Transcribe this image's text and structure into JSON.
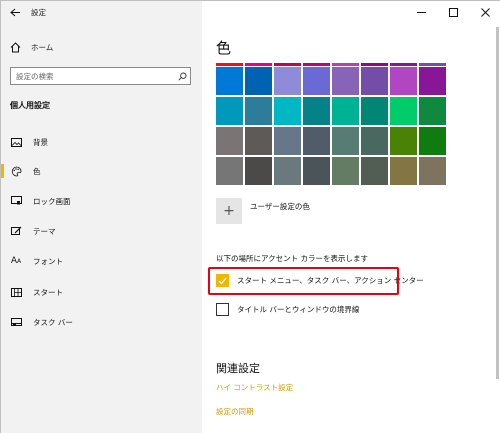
{
  "window": {
    "title": "設定"
  },
  "sidebar": {
    "home_label": "ホーム",
    "search_placeholder": "設定の検索",
    "section_title": "個人用設定",
    "items": [
      {
        "label": "背景",
        "icon": "image-icon"
      },
      {
        "label": "色",
        "icon": "palette-icon"
      },
      {
        "label": "ロック画面",
        "icon": "lock-screen-icon"
      },
      {
        "label": "テーマ",
        "icon": "theme-brush-icon"
      },
      {
        "label": "フォント",
        "icon": "font-icon"
      },
      {
        "label": "スタート",
        "icon": "start-grid-icon"
      },
      {
        "label": "タスク バー",
        "icon": "taskbar-icon"
      }
    ],
    "active_index": 1
  },
  "main": {
    "title": "色",
    "top_strip_colors": [
      "#e81123",
      "#e3008c",
      "#c30052",
      "#bf0077",
      "#c239b3",
      "#9a0089",
      "#881798",
      "#744da9",
      "#b146c2"
    ],
    "swatch_rows": [
      [
        "#0078d7",
        "#0063b1",
        "#8e8cd8",
        "#6b69d6",
        "#8764b8",
        "#744da9",
        "#b146c2",
        "#881798"
      ],
      [
        "#0099bc",
        "#2d7d9a",
        "#00b7c3",
        "#038387",
        "#00b294",
        "#018574",
        "#00cc6a",
        "#10893e"
      ],
      [
        "#7a7574",
        "#5d5a58",
        "#68768a",
        "#515c6b",
        "#567c73",
        "#486860",
        "#498205",
        "#107c10"
      ],
      [
        "#767676",
        "#4c4a48",
        "#69797e",
        "#4a5459",
        "#647c64",
        "#525e54",
        "#847545",
        "#7e735f"
      ]
    ],
    "custom_color_label": "ユーザー設定の色",
    "accent_heading": "以下の場所にアクセント カラーを表示します",
    "option_start": "スタート メニュー、タスク バー、アクション センター",
    "option_start_checked": true,
    "option_titlebar": "タイトル バーとウィンドウの境界線",
    "option_titlebar_checked": false,
    "related_heading": "関連設定",
    "link_high_contrast": "ハイ コントラスト設定",
    "link_sync": "設定の同期"
  },
  "colors": {
    "accent": "#f5b400",
    "highlight_border": "#e60012",
    "link": "#d09b00"
  }
}
